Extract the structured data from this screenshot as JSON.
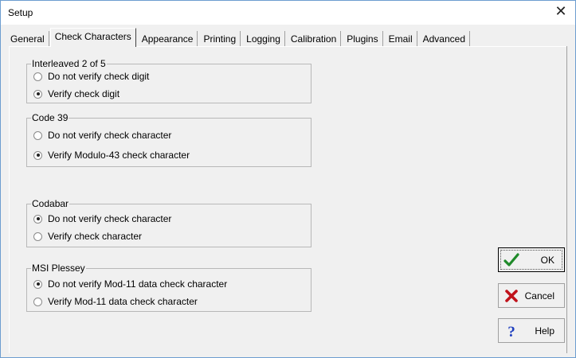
{
  "window": {
    "title": "Setup",
    "close_glyph": "✕"
  },
  "tabs": [
    {
      "label": "General",
      "active": false
    },
    {
      "label": "Check Characters",
      "active": true
    },
    {
      "label": "Appearance",
      "active": false
    },
    {
      "label": "Printing",
      "active": false
    },
    {
      "label": "Logging",
      "active": false
    },
    {
      "label": "Calibration",
      "active": false
    },
    {
      "label": "Plugins",
      "active": false
    },
    {
      "label": "Email",
      "active": false
    },
    {
      "label": "Advanced",
      "active": false
    }
  ],
  "groups": {
    "interleaved": {
      "title": "Interleaved 2 of 5",
      "options": [
        {
          "label": "Do not verify check digit",
          "selected": false
        },
        {
          "label": "Verify check digit",
          "selected": true
        }
      ]
    },
    "code39": {
      "title": "Code 39",
      "options": [
        {
          "label": "Do not verify check character",
          "selected": false
        },
        {
          "label": "Verify Modulo-43 check character",
          "selected": true
        }
      ]
    },
    "codabar": {
      "title": "Codabar",
      "options": [
        {
          "label": "Do not verify check character",
          "selected": true
        },
        {
          "label": "Verify check character",
          "selected": false
        }
      ]
    },
    "msi": {
      "title": "MSI Plessey",
      "options": [
        {
          "label": "Do not verify Mod-11 data check character",
          "selected": true
        },
        {
          "label": "Verify Mod-11 data check character",
          "selected": false
        }
      ]
    }
  },
  "buttons": {
    "ok": "OK",
    "cancel": "Cancel",
    "help": "Help"
  },
  "colors": {
    "ok_check": "#1f8a2a",
    "cancel_x": "#c0121b",
    "help_q": "#1f3fbf"
  }
}
